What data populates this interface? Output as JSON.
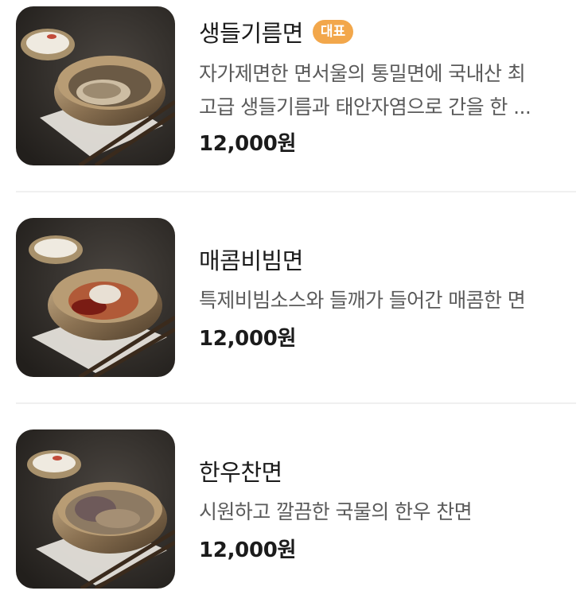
{
  "menu": {
    "items": [
      {
        "name": "생들기름면",
        "badge": "대표",
        "description_line1": "자가제면한 면서울의 통밀면에 국내산 최",
        "description_line2": "고급 생들기름과 태안자염으로 간을 한 ...",
        "price": "12,000원",
        "image": "noodle-dish-photo"
      },
      {
        "name": "매콤비빔면",
        "description_line1": "특제비빔소스와 들깨가 들어간 매콤한 면",
        "price": "12,000원",
        "image": "noodle-dish-photo"
      },
      {
        "name": "한우찬면",
        "description_line1": "시원하고 깔끔한 국물의 한우 찬면",
        "price": "12,000원",
        "image": "noodle-dish-photo"
      }
    ]
  },
  "colors": {
    "badge_bg": "#f2a74b",
    "title": "#1b1b1b",
    "description": "#5a5a5a",
    "divider": "#f0f0f0"
  }
}
